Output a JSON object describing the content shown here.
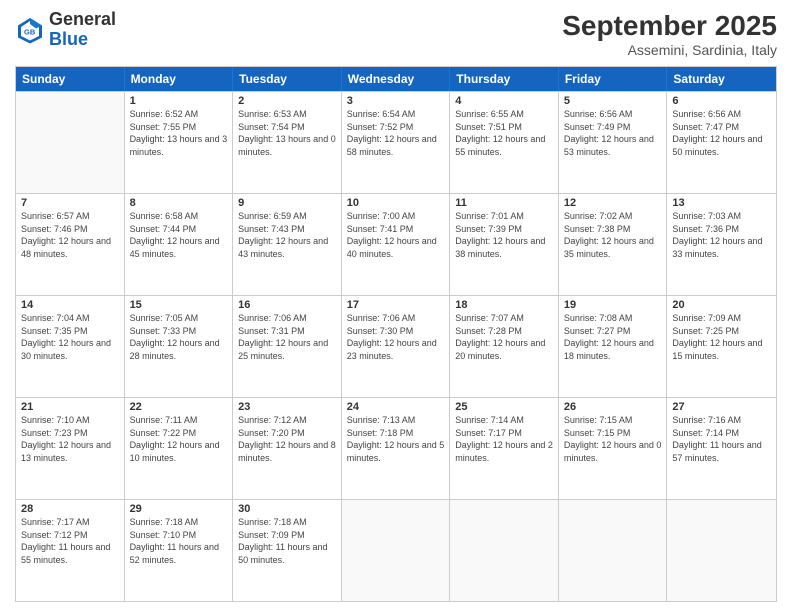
{
  "logo": {
    "text_general": "General",
    "text_blue": "Blue"
  },
  "header": {
    "month_title": "September 2025",
    "subtitle": "Assemini, Sardinia, Italy"
  },
  "days_of_week": [
    "Sunday",
    "Monday",
    "Tuesday",
    "Wednesday",
    "Thursday",
    "Friday",
    "Saturday"
  ],
  "weeks": [
    [
      {
        "day": "",
        "sunrise": "",
        "sunset": "",
        "daylight": ""
      },
      {
        "day": "1",
        "sunrise": "Sunrise: 6:52 AM",
        "sunset": "Sunset: 7:55 PM",
        "daylight": "Daylight: 13 hours and 3 minutes."
      },
      {
        "day": "2",
        "sunrise": "Sunrise: 6:53 AM",
        "sunset": "Sunset: 7:54 PM",
        "daylight": "Daylight: 13 hours and 0 minutes."
      },
      {
        "day": "3",
        "sunrise": "Sunrise: 6:54 AM",
        "sunset": "Sunset: 7:52 PM",
        "daylight": "Daylight: 12 hours and 58 minutes."
      },
      {
        "day": "4",
        "sunrise": "Sunrise: 6:55 AM",
        "sunset": "Sunset: 7:51 PM",
        "daylight": "Daylight: 12 hours and 55 minutes."
      },
      {
        "day": "5",
        "sunrise": "Sunrise: 6:56 AM",
        "sunset": "Sunset: 7:49 PM",
        "daylight": "Daylight: 12 hours and 53 minutes."
      },
      {
        "day": "6",
        "sunrise": "Sunrise: 6:56 AM",
        "sunset": "Sunset: 7:47 PM",
        "daylight": "Daylight: 12 hours and 50 minutes."
      }
    ],
    [
      {
        "day": "7",
        "sunrise": "Sunrise: 6:57 AM",
        "sunset": "Sunset: 7:46 PM",
        "daylight": "Daylight: 12 hours and 48 minutes."
      },
      {
        "day": "8",
        "sunrise": "Sunrise: 6:58 AM",
        "sunset": "Sunset: 7:44 PM",
        "daylight": "Daylight: 12 hours and 45 minutes."
      },
      {
        "day": "9",
        "sunrise": "Sunrise: 6:59 AM",
        "sunset": "Sunset: 7:43 PM",
        "daylight": "Daylight: 12 hours and 43 minutes."
      },
      {
        "day": "10",
        "sunrise": "Sunrise: 7:00 AM",
        "sunset": "Sunset: 7:41 PM",
        "daylight": "Daylight: 12 hours and 40 minutes."
      },
      {
        "day": "11",
        "sunrise": "Sunrise: 7:01 AM",
        "sunset": "Sunset: 7:39 PM",
        "daylight": "Daylight: 12 hours and 38 minutes."
      },
      {
        "day": "12",
        "sunrise": "Sunrise: 7:02 AM",
        "sunset": "Sunset: 7:38 PM",
        "daylight": "Daylight: 12 hours and 35 minutes."
      },
      {
        "day": "13",
        "sunrise": "Sunrise: 7:03 AM",
        "sunset": "Sunset: 7:36 PM",
        "daylight": "Daylight: 12 hours and 33 minutes."
      }
    ],
    [
      {
        "day": "14",
        "sunrise": "Sunrise: 7:04 AM",
        "sunset": "Sunset: 7:35 PM",
        "daylight": "Daylight: 12 hours and 30 minutes."
      },
      {
        "day": "15",
        "sunrise": "Sunrise: 7:05 AM",
        "sunset": "Sunset: 7:33 PM",
        "daylight": "Daylight: 12 hours and 28 minutes."
      },
      {
        "day": "16",
        "sunrise": "Sunrise: 7:06 AM",
        "sunset": "Sunset: 7:31 PM",
        "daylight": "Daylight: 12 hours and 25 minutes."
      },
      {
        "day": "17",
        "sunrise": "Sunrise: 7:06 AM",
        "sunset": "Sunset: 7:30 PM",
        "daylight": "Daylight: 12 hours and 23 minutes."
      },
      {
        "day": "18",
        "sunrise": "Sunrise: 7:07 AM",
        "sunset": "Sunset: 7:28 PM",
        "daylight": "Daylight: 12 hours and 20 minutes."
      },
      {
        "day": "19",
        "sunrise": "Sunrise: 7:08 AM",
        "sunset": "Sunset: 7:27 PM",
        "daylight": "Daylight: 12 hours and 18 minutes."
      },
      {
        "day": "20",
        "sunrise": "Sunrise: 7:09 AM",
        "sunset": "Sunset: 7:25 PM",
        "daylight": "Daylight: 12 hours and 15 minutes."
      }
    ],
    [
      {
        "day": "21",
        "sunrise": "Sunrise: 7:10 AM",
        "sunset": "Sunset: 7:23 PM",
        "daylight": "Daylight: 12 hours and 13 minutes."
      },
      {
        "day": "22",
        "sunrise": "Sunrise: 7:11 AM",
        "sunset": "Sunset: 7:22 PM",
        "daylight": "Daylight: 12 hours and 10 minutes."
      },
      {
        "day": "23",
        "sunrise": "Sunrise: 7:12 AM",
        "sunset": "Sunset: 7:20 PM",
        "daylight": "Daylight: 12 hours and 8 minutes."
      },
      {
        "day": "24",
        "sunrise": "Sunrise: 7:13 AM",
        "sunset": "Sunset: 7:18 PM",
        "daylight": "Daylight: 12 hours and 5 minutes."
      },
      {
        "day": "25",
        "sunrise": "Sunrise: 7:14 AM",
        "sunset": "Sunset: 7:17 PM",
        "daylight": "Daylight: 12 hours and 2 minutes."
      },
      {
        "day": "26",
        "sunrise": "Sunrise: 7:15 AM",
        "sunset": "Sunset: 7:15 PM",
        "daylight": "Daylight: 12 hours and 0 minutes."
      },
      {
        "day": "27",
        "sunrise": "Sunrise: 7:16 AM",
        "sunset": "Sunset: 7:14 PM",
        "daylight": "Daylight: 11 hours and 57 minutes."
      }
    ],
    [
      {
        "day": "28",
        "sunrise": "Sunrise: 7:17 AM",
        "sunset": "Sunset: 7:12 PM",
        "daylight": "Daylight: 11 hours and 55 minutes."
      },
      {
        "day": "29",
        "sunrise": "Sunrise: 7:18 AM",
        "sunset": "Sunset: 7:10 PM",
        "daylight": "Daylight: 11 hours and 52 minutes."
      },
      {
        "day": "30",
        "sunrise": "Sunrise: 7:18 AM",
        "sunset": "Sunset: 7:09 PM",
        "daylight": "Daylight: 11 hours and 50 minutes."
      },
      {
        "day": "",
        "sunrise": "",
        "sunset": "",
        "daylight": ""
      },
      {
        "day": "",
        "sunrise": "",
        "sunset": "",
        "daylight": ""
      },
      {
        "day": "",
        "sunrise": "",
        "sunset": "",
        "daylight": ""
      },
      {
        "day": "",
        "sunrise": "",
        "sunset": "",
        "daylight": ""
      }
    ]
  ]
}
